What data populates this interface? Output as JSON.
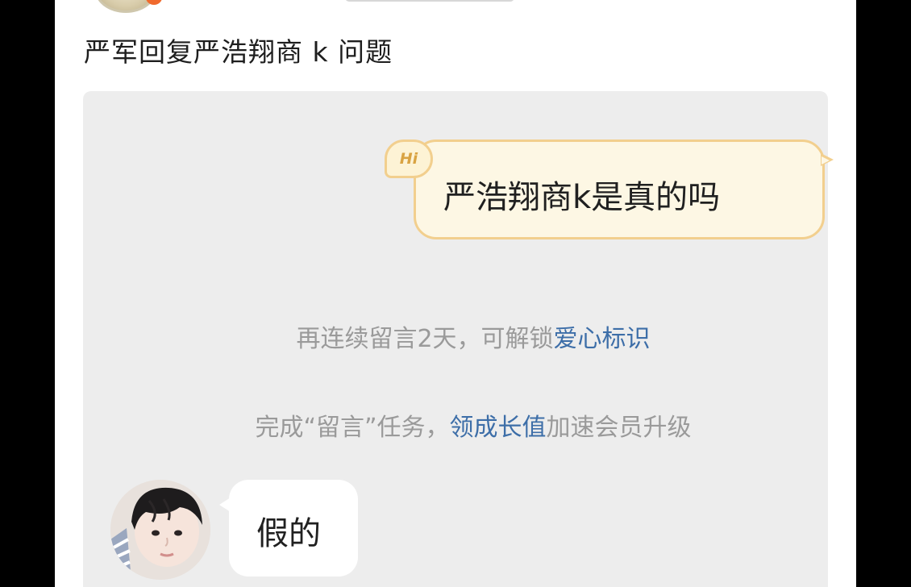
{
  "post": {
    "title": "严军回复严浩翔商 k 问题"
  },
  "chat": {
    "question": {
      "badge": "Hi",
      "text": "严浩翔商k是真的吗"
    },
    "tips": {
      "line1_prefix": "再连续留言2天，可解锁",
      "line1_link": "爱心标识",
      "line2_prefix": "完成“留言”任务，",
      "line2_link": "领成长值",
      "line2_suffix": "加速会员升级"
    },
    "reply": {
      "text": "假的"
    }
  },
  "colors": {
    "page_bg": "#ffffff",
    "card_bg": "#ededed",
    "question_bubble_bg": "#fdf7e4",
    "question_bubble_border": "#f2cf8e",
    "tip_text": "#9a9a9a",
    "link": "#3d6ea8"
  },
  "icons": {
    "top_avatar": "user-avatar-icon",
    "reply_avatar": "user-avatar-icon",
    "hi_badge": "hi-badge-icon"
  }
}
